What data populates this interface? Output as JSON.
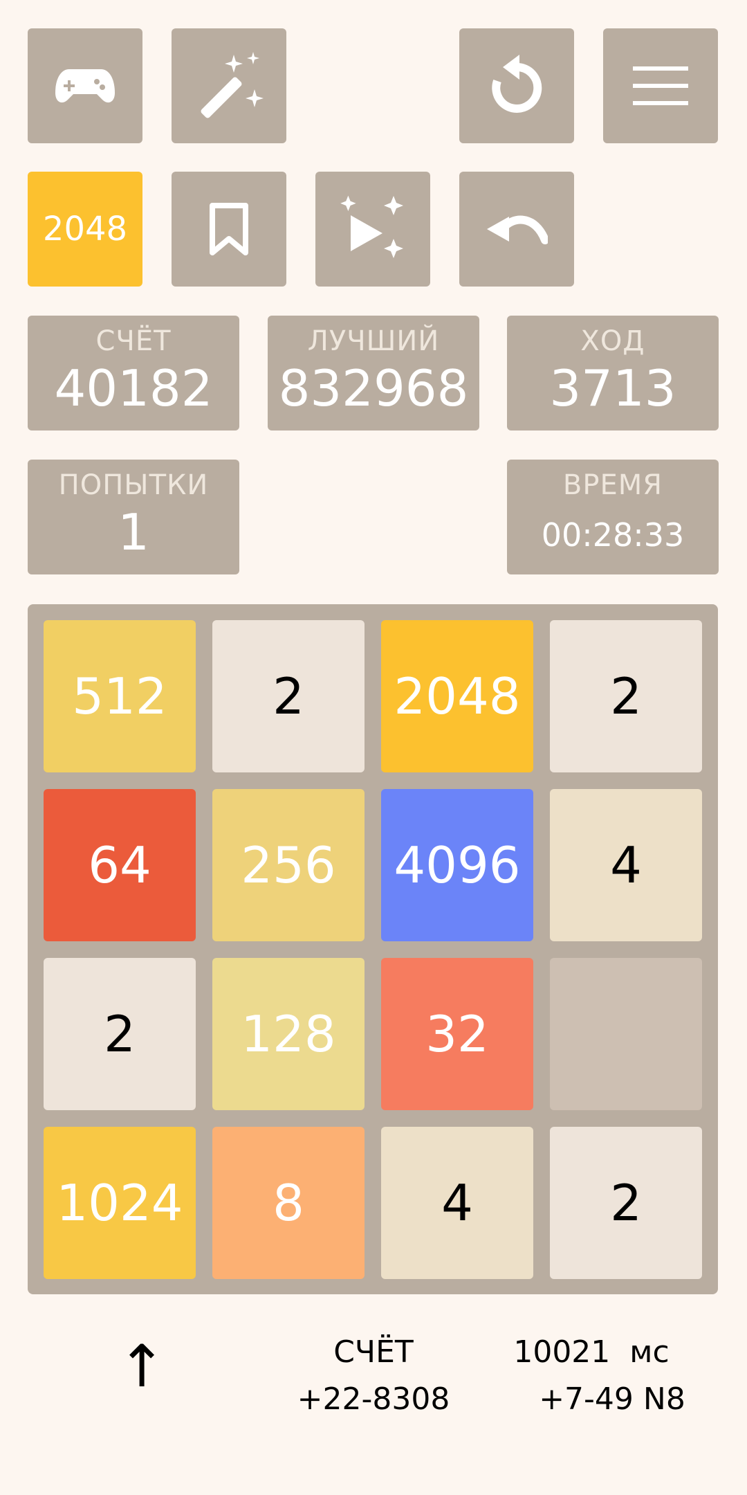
{
  "toolbar": {
    "row1": [
      {
        "name": "gamepad-button",
        "icon": "gamepad-icon"
      },
      {
        "name": "magic-wand-button",
        "icon": "magic-wand-icon"
      },
      {
        "name": "restart-button",
        "icon": "restart-icon"
      },
      {
        "name": "menu-button",
        "icon": "menu-icon"
      }
    ],
    "row2": [
      {
        "name": "logo-button",
        "label": "2048"
      },
      {
        "name": "bookmark-button",
        "icon": "bookmark-icon"
      },
      {
        "name": "autoplay-button",
        "icon": "play-sparkle-icon"
      },
      {
        "name": "undo-button",
        "icon": "undo-icon"
      }
    ]
  },
  "stats": {
    "score": {
      "label": "СЧЁТ",
      "value": "40182"
    },
    "best": {
      "label": "ЛУЧШИЙ",
      "value": "832968"
    },
    "moves": {
      "label": "ХОД",
      "value": "3713"
    },
    "attempts": {
      "label": "ПОПЫТКИ",
      "value": "1"
    },
    "time": {
      "label": "ВРЕМЯ",
      "value": "00:28:33"
    }
  },
  "board": {
    "rows": [
      [
        "512",
        "2",
        "2048",
        "2"
      ],
      [
        "64",
        "256",
        "4096",
        "4"
      ],
      [
        "2",
        "128",
        "32",
        ""
      ],
      [
        "1024",
        "8",
        "4",
        "2"
      ]
    ]
  },
  "footer": {
    "arrow": "↑",
    "score_label": "СЧЁТ",
    "score_delta": "+22-8308",
    "time_ms": "10021  мс",
    "extra": "+7-49 N8"
  },
  "colors": {
    "background": "#fdf6f0",
    "panel": "#b9ada0",
    "empty_cell": "#cdbfb2",
    "logo": "#fcc12f"
  }
}
